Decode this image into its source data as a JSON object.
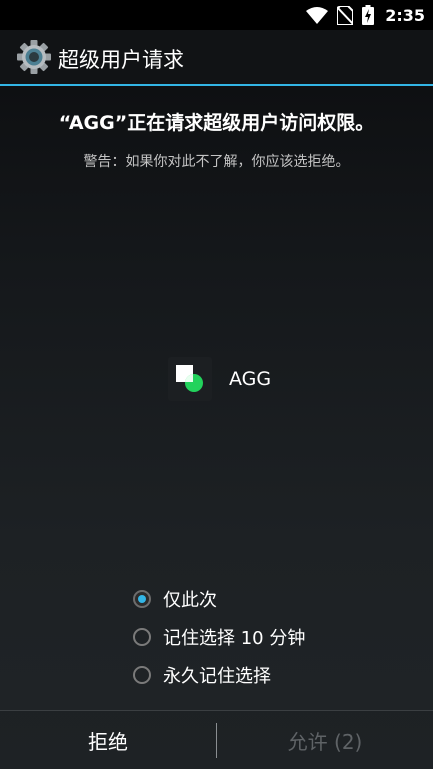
{
  "status_bar": {
    "time": "2:35",
    "icons": [
      "wifi-icon",
      "no-sim-icon",
      "battery-charging-icon"
    ]
  },
  "title_bar": {
    "icon": "gear-icon",
    "title": "超级用户请求"
  },
  "request": {
    "headline": "“AGG”正在请求超级用户访问权限。",
    "warning": "警告：如果你对此不了解，你应该选拒绝。"
  },
  "app": {
    "name": "AGG",
    "icon": "app-icon"
  },
  "options": [
    {
      "label": "仅此次",
      "selected": true
    },
    {
      "label": "记住选择 10 分钟",
      "selected": false
    },
    {
      "label": "永久记住选择",
      "selected": false
    }
  ],
  "buttons": {
    "deny": "拒绝",
    "allow": "允许 (2)"
  },
  "colors": {
    "accent": "#33b5e5",
    "allow_disabled": "#5f6366"
  }
}
